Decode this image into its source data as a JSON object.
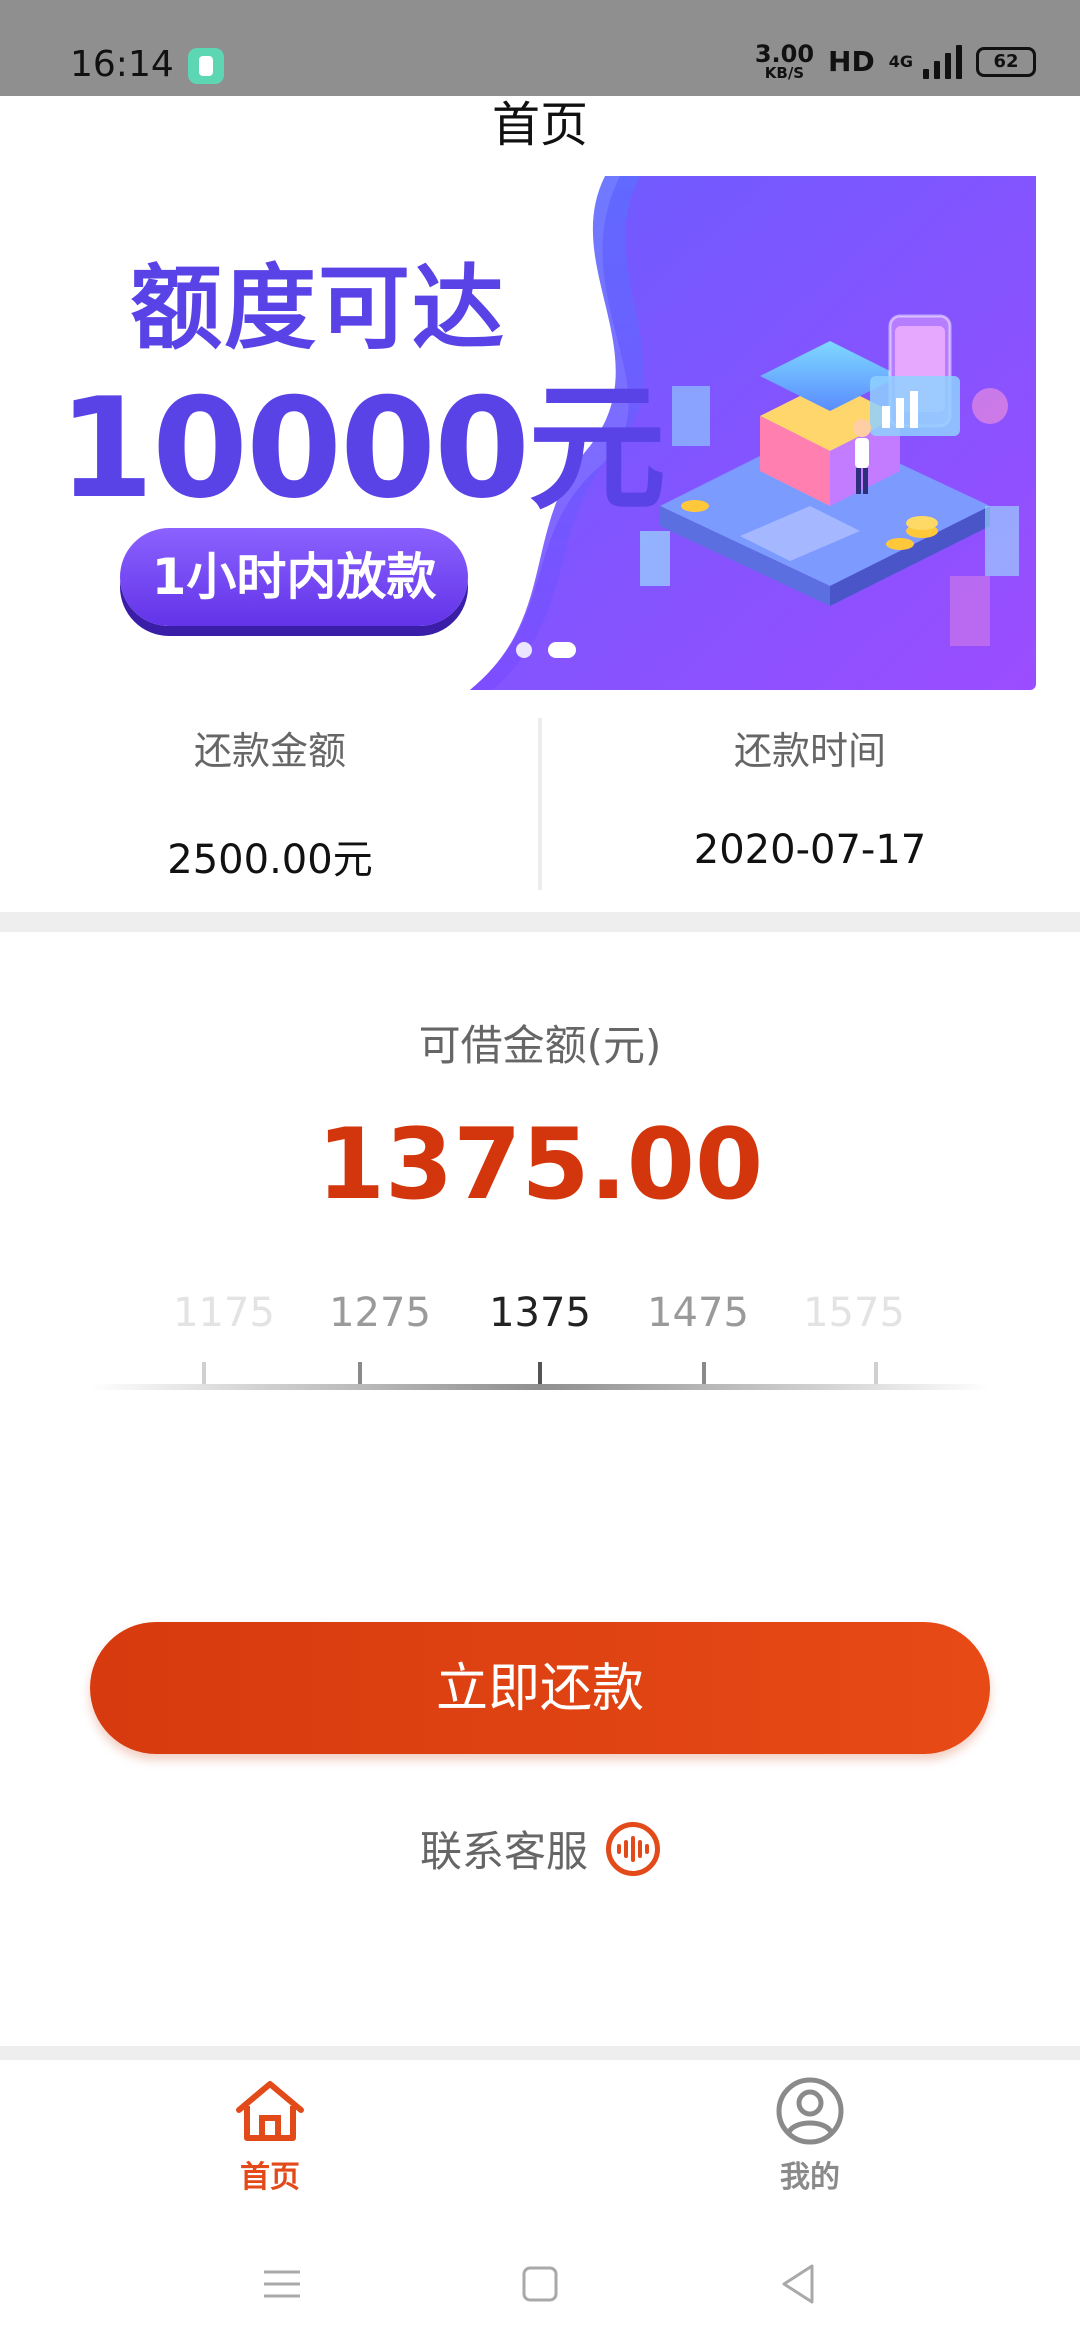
{
  "status_bar": {
    "time": "16:14",
    "speed_value": "3.00",
    "speed_unit": "KB/S",
    "hd": "HD",
    "network": "4G",
    "battery": "62"
  },
  "header": {
    "title": "首页"
  },
  "banner": {
    "headline": "额度可达",
    "amount": "10000元",
    "cta": "1小时内放款",
    "slides": 2,
    "active_slide": 2
  },
  "repayment": {
    "amount_label": "还款金额",
    "amount_value": "2500.00元",
    "date_label": "还款时间",
    "date_value": "2020-07-17"
  },
  "borrow": {
    "label": "可借金额(元)",
    "amount": "1375.00",
    "ruler": {
      "ticks": [
        "1175",
        "1275",
        "1375",
        "1475",
        "1575"
      ],
      "selected": "1375"
    }
  },
  "actions": {
    "repay_button": "立即还款",
    "service_text": "联系客服"
  },
  "tab_bar": {
    "home": "首页",
    "mine": "我的",
    "active": "home"
  },
  "colors": {
    "accent": "#e24a1a",
    "amount_red": "#d3360c",
    "banner_purple": "#5a43e6"
  }
}
